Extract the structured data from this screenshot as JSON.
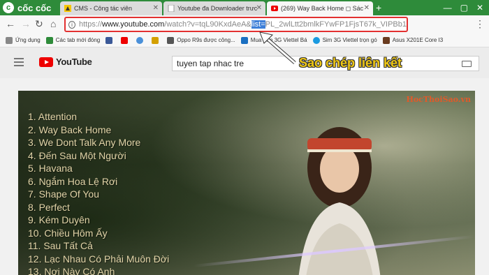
{
  "browser": {
    "brand": "cốc cốc",
    "tabs": [
      {
        "label": "CMS - Công tác viên",
        "icon": "cms-icon"
      },
      {
        "label": "Youtube đa Downloader trưc",
        "icon": "page-icon"
      },
      {
        "label": "(269) Way Back Home ◻ Sác",
        "icon": "youtube-icon"
      }
    ],
    "url": {
      "scheme": "https://",
      "host": "www.youtube.com",
      "path_before": "/watch?v=tqL90KxdAeA&",
      "selected": "list=",
      "path_after": "PL_2wlLtt2bmlkFYwFP1FjsT67k_VIPBb1"
    }
  },
  "bookmarks": [
    {
      "label": "Ứng dụng",
      "color": "#888888"
    },
    {
      "label": "Các tab mới đóng",
      "color": "#2e8b3a"
    },
    {
      "label": "",
      "color": "#3b5998"
    },
    {
      "label": "",
      "color": "#e00000"
    },
    {
      "label": "",
      "color": "#4a90d9"
    },
    {
      "label": "",
      "color": "#d4a000"
    },
    {
      "label": "Oppo R9s được công...",
      "color": "#555555"
    },
    {
      "label": "Mua Sim 3G Viettel Bá",
      "color": "#1a6fc1"
    },
    {
      "label": "Sim 3G Viettel trọn gó",
      "color": "#1a9ae0"
    },
    {
      "label": "Asus X201E Core I3",
      "color": "#6a3c20"
    }
  ],
  "youtube": {
    "logo_text": "YouTube",
    "search_value": "tuyen tap nhac tre"
  },
  "video": {
    "watermark": "HocThoiSao.vn",
    "playlist": [
      "1. Attention",
      "2. Way Back Home",
      "3. We Dont Talk Any More",
      "4. Đến Sau Một Người",
      "5. Havana",
      "6. Ngắm Hoa Lệ Rơi",
      "7. Shape Of You",
      "8. Perfect",
      "9. Kém Duyên",
      "10. Chiều Hôm Ấy",
      "11. Sau Tất Cả",
      "12. Lạc Nhau Có Phải Muôn Đời",
      "13. Nơi Này Có Anh"
    ]
  },
  "annotation": {
    "text": "Sao chép liên kết",
    "color": "#f0c814"
  },
  "colors": {
    "tabstrip": "#2e8b3a",
    "highlight_border": "#e23030",
    "selection": "#3d7fd8"
  }
}
